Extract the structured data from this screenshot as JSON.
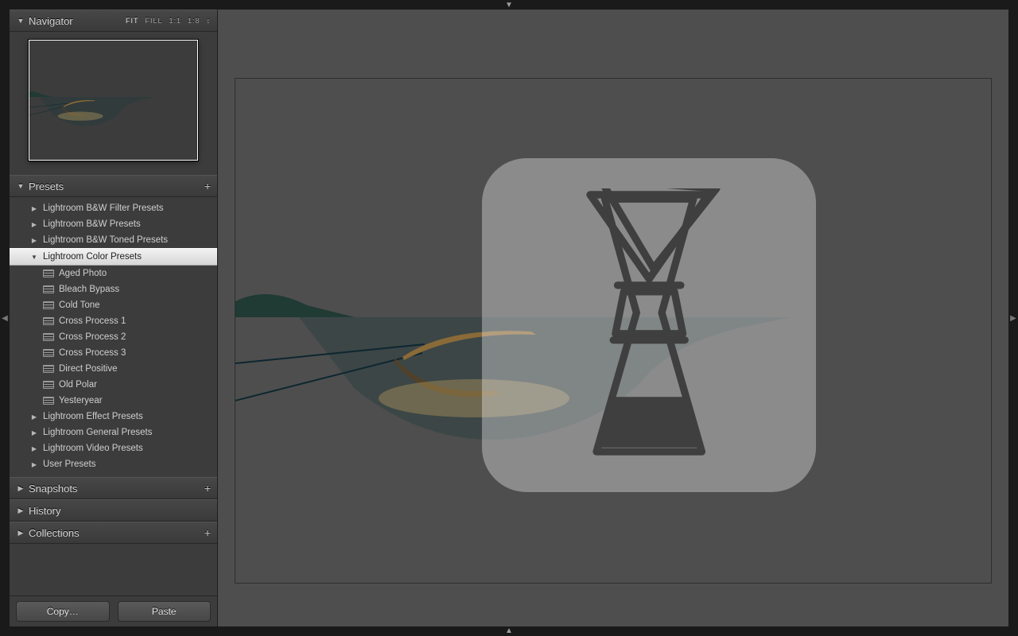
{
  "navigator": {
    "title": "Navigator",
    "zoom_levels": [
      "FIT",
      "FILL",
      "1:1",
      "1:8"
    ],
    "zoom_selected": "FIT",
    "updown_glyph": "↕"
  },
  "presets": {
    "title": "Presets",
    "folders": [
      {
        "label": "Lightroom B&W Filter Presets",
        "expanded": false
      },
      {
        "label": "Lightroom B&W Presets",
        "expanded": false
      },
      {
        "label": "Lightroom B&W Toned Presets",
        "expanded": false
      },
      {
        "label": "Lightroom Color Presets",
        "expanded": true,
        "selected": true,
        "children": [
          "Aged Photo",
          "Bleach Bypass",
          "Cold Tone",
          "Cross Process 1",
          "Cross Process 2",
          "Cross Process 3",
          "Direct Positive",
          "Old Polar",
          "Yesteryear"
        ]
      },
      {
        "label": "Lightroom Effect Presets",
        "expanded": false
      },
      {
        "label": "Lightroom General Presets",
        "expanded": false
      },
      {
        "label": "Lightroom Video Presets",
        "expanded": false
      },
      {
        "label": "User Presets",
        "expanded": false
      }
    ]
  },
  "snapshots": {
    "title": "Snapshots"
  },
  "history": {
    "title": "History"
  },
  "collections": {
    "title": "Collections"
  },
  "buttons": {
    "copy": "Copy…",
    "paste": "Paste"
  },
  "overlay_icon": "chemex-icon"
}
